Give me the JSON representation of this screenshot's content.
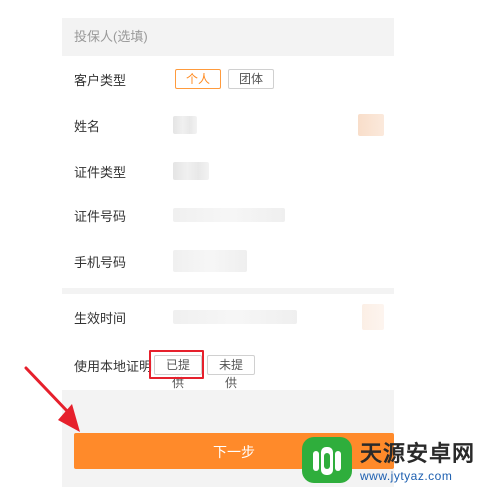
{
  "section": {
    "title": "投保人(选填)"
  },
  "rows": {
    "customer_type": {
      "label": "客户类型",
      "options": [
        "个人",
        "团体"
      ],
      "selected": "个人"
    },
    "name": {
      "label": "姓名"
    },
    "id_type": {
      "label": "证件类型"
    },
    "id_number": {
      "label": "证件号码"
    },
    "phone": {
      "label": "手机号码"
    },
    "effective_time": {
      "label": "生效时间"
    },
    "local_cert": {
      "label": "使用本地证明",
      "options": [
        "已提供",
        "未提供"
      ],
      "highlighted": "已提供"
    }
  },
  "actions": {
    "next_label": "下一步"
  },
  "colors": {
    "accent": "#ff8a2a",
    "highlight_box": "#e6202c",
    "arrow": "#e6202c"
  },
  "watermark": {
    "title": "天源安卓网",
    "url": "www.jytyaz.com"
  }
}
